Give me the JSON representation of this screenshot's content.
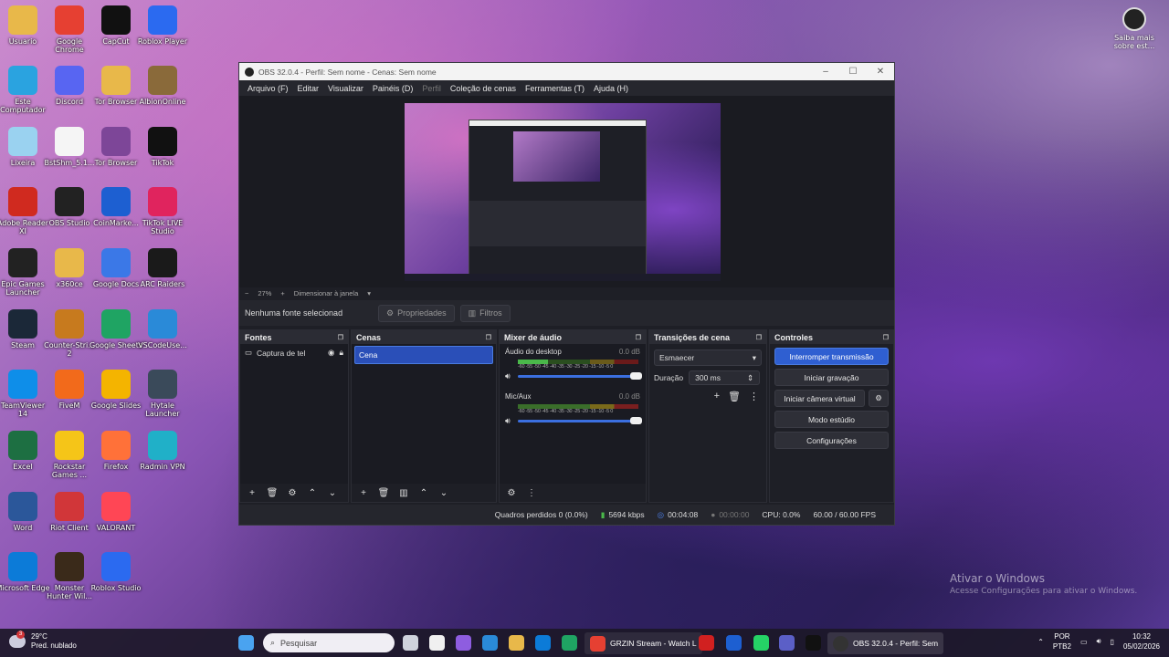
{
  "desktop": {
    "icons": [
      {
        "label": "Usuario",
        "icon": "folder-icon",
        "color": "#e8b84a"
      },
      {
        "label": "Google Chrome",
        "icon": "chrome-icon",
        "color": "#e64032"
      },
      {
        "label": "CapCut",
        "icon": "capcut-icon",
        "color": "#111111"
      },
      {
        "label": "Roblox Player",
        "icon": "roblox-icon",
        "color": "#2b6af0"
      },
      {
        "label": "Este Computador",
        "icon": "computer-icon",
        "color": "#2aa3e0"
      },
      {
        "label": "Discord",
        "icon": "discord-icon",
        "color": "#5865f2"
      },
      {
        "label": "Tor Browser",
        "icon": "folder-icon",
        "color": "#e8b84a"
      },
      {
        "label": "AlbionOnline",
        "icon": "albion-icon",
        "color": "#8a6a3a"
      },
      {
        "label": "Lixeira",
        "icon": "recycle-bin-icon",
        "color": "#9ad2f0"
      },
      {
        "label": "BstShm_5.1...",
        "icon": "file-icon",
        "color": "#f5f5f5"
      },
      {
        "label": "Tor Browser",
        "icon": "tor-icon",
        "color": "#7d4698"
      },
      {
        "label": "TikTok",
        "icon": "tiktok-icon",
        "color": "#111111"
      },
      {
        "label": "Adobe Reader XI",
        "icon": "adobe-icon",
        "color": "#d02a1f"
      },
      {
        "label": "OBS Studio",
        "icon": "obs-icon",
        "color": "#222222"
      },
      {
        "label": "CoinMarke...",
        "icon": "coinmarketcap-icon",
        "color": "#1d5fd1"
      },
      {
        "label": "TikTok LIVE Studio",
        "icon": "tiktok-live-icon",
        "color": "#e0245e"
      },
      {
        "label": "Epic Games Launcher",
        "icon": "epic-icon",
        "color": "#222222"
      },
      {
        "label": "x360ce",
        "icon": "folder-icon",
        "color": "#e8b84a"
      },
      {
        "label": "Google Docs",
        "icon": "google-docs-icon",
        "color": "#3b78e7"
      },
      {
        "label": "ARC Raiders",
        "icon": "arc-raiders-icon",
        "color": "#1a1a1a"
      },
      {
        "label": "Steam",
        "icon": "steam-icon",
        "color": "#1b2838"
      },
      {
        "label": "Counter-Stri... 2",
        "icon": "cs2-icon",
        "color": "#c77a1e"
      },
      {
        "label": "Google Sheets",
        "icon": "google-sheets-icon",
        "color": "#1fa463"
      },
      {
        "label": "VSCodeUse...",
        "icon": "vscode-icon",
        "color": "#2a8ad8"
      },
      {
        "label": "TeamViewer 14",
        "icon": "teamviewer-icon",
        "color": "#0e8ee9"
      },
      {
        "label": "FiveM",
        "icon": "fivem-icon",
        "color": "#f26a1b"
      },
      {
        "label": "Google Slides",
        "icon": "google-slides-icon",
        "color": "#f4b400"
      },
      {
        "label": "Hytale Launcher",
        "icon": "hytale-icon",
        "color": "#3a4a5a"
      },
      {
        "label": "Excel",
        "icon": "excel-icon",
        "color": "#1d6f42"
      },
      {
        "label": "Rockstar Games ...",
        "icon": "rockstar-icon",
        "color": "#f5c518"
      },
      {
        "label": "Firefox",
        "icon": "firefox-icon",
        "color": "#ff7139"
      },
      {
        "label": "Radmin VPN",
        "icon": "radmin-icon",
        "color": "#20b0c8"
      },
      {
        "label": "Word",
        "icon": "word-icon",
        "color": "#2b579a"
      },
      {
        "label": "Riot Client",
        "icon": "riot-icon",
        "color": "#d13639"
      },
      {
        "label": "VALORANT",
        "icon": "valorant-icon",
        "color": "#ff4655"
      },
      {
        "label": "",
        "icon": "",
        "color": ""
      },
      {
        "label": "Microsoft Edge",
        "icon": "edge-icon",
        "color": "#0c7bd8"
      },
      {
        "label": "Monster Hunter Wil...",
        "icon": "monster-hunter-icon",
        "color": "#3a2a1a"
      },
      {
        "label": "Roblox Studio",
        "icon": "roblox-studio-icon",
        "color": "#2b6af0"
      }
    ],
    "saiba_mais": "Saiba mais sobre est...",
    "watermark_title": "Ativar o Windows",
    "watermark_text": "Acesse Configurações para ativar o Windows."
  },
  "obs": {
    "title": "OBS 32.0.4 - Perfil: Sem nome - Cenas: Sem nome",
    "menu": [
      "Arquivo (F)",
      "Editar",
      "Visualizar",
      "Painéis (D)",
      "Perfil",
      "Coleção de cenas",
      "Ferramentas (T)",
      "Ajuda (H)"
    ],
    "zoom": "27%",
    "zoom_minus": "−",
    "zoom_plus": "+",
    "resize_label": "Dimensionar à janela",
    "no_source": "Nenhuma fonte selecionad",
    "properties": "Propriedades",
    "filters": "Filtros",
    "docks": {
      "fontes": "Fontes",
      "cenas": "Cenas",
      "mixer": "Mixer de áudio",
      "transicoes": "Transições de cena",
      "controles": "Controles"
    },
    "source_item": "Captura de tel",
    "scene_item": "Cena",
    "mixer": {
      "ch1_name": "Áudio do desktop",
      "ch1_db": "0.0 dB",
      "ch2_name": "Mic/Aux",
      "ch2_db": "0.0 dB",
      "ticks": "-60 -55 -50 -45 -40 -35 -30 -25 -20 -15 -10 -5 0"
    },
    "transition": {
      "type": "Esmaecer",
      "duration_label": "Duração",
      "duration_value": "300 ms"
    },
    "controls": {
      "stop_stream": "Interromper transmissão",
      "start_record": "Iniciar gravação",
      "virtual_cam": "Iniciar câmera virtual",
      "studio_mode": "Modo estúdio",
      "settings": "Configurações"
    },
    "status": {
      "dropped": "Quadros perdidos 0 (0.0%)",
      "bitrate": "5694 kbps",
      "stream_time": "00:04:08",
      "rec_time": "00:00:00",
      "cpu": "CPU: 0.0%",
      "fps": "60.00 / 60.00 FPS"
    },
    "colors": {
      "accent": "#2f5fd1",
      "bg": "#1e1f26"
    }
  },
  "taskbar": {
    "temp": "29°C",
    "weather": "Pred. nublado",
    "weather_badge": "3",
    "search_placeholder": "Pesquisar",
    "chrome_app": "GRZIN Stream - Watch L",
    "obs_app": "OBS 32.0.4 - Perfil: Sem",
    "lang1": "POR",
    "lang2": "PTB2",
    "time": "10:32",
    "date": "05/02/2026"
  }
}
